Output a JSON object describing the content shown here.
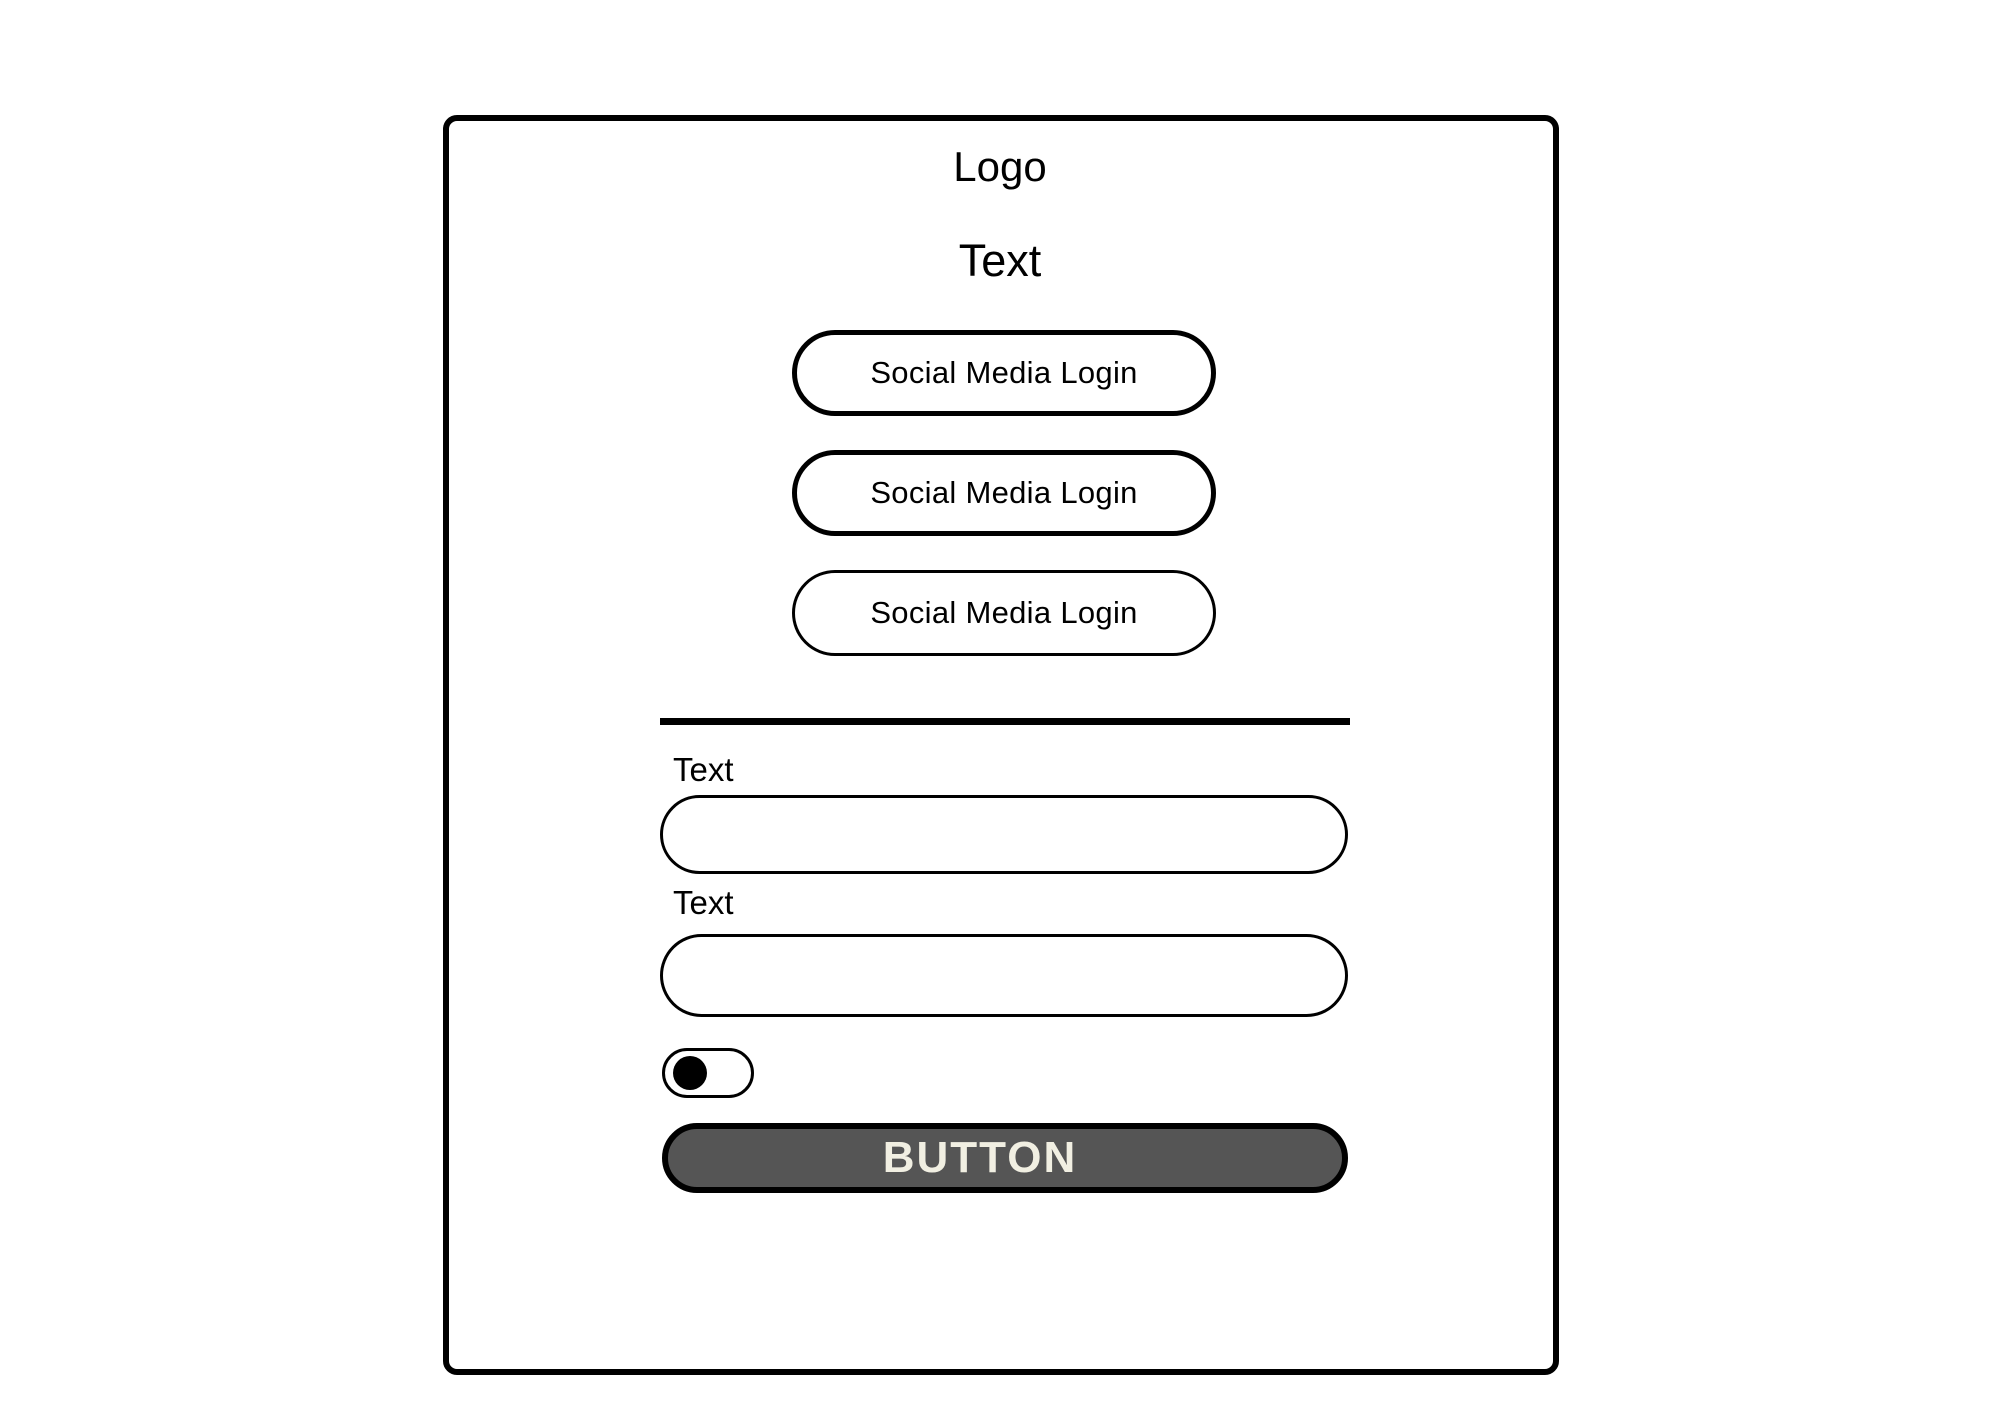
{
  "header": {
    "logo_text": "Logo",
    "headline": "Text"
  },
  "social_logins": [
    {
      "label": "Social Media Login"
    },
    {
      "label": "Social Media Login"
    },
    {
      "label": "Social Media Login"
    }
  ],
  "form": {
    "fields": [
      {
        "label": "Text",
        "value": "",
        "placeholder": ""
      },
      {
        "label": "Text",
        "value": "",
        "placeholder": ""
      }
    ],
    "toggle": {
      "state": "off"
    },
    "submit_label": "BUTTON"
  },
  "colors": {
    "outline": "#000000",
    "background": "#ffffff",
    "button_fill": "#555555",
    "button_text": "#f1efe2"
  }
}
